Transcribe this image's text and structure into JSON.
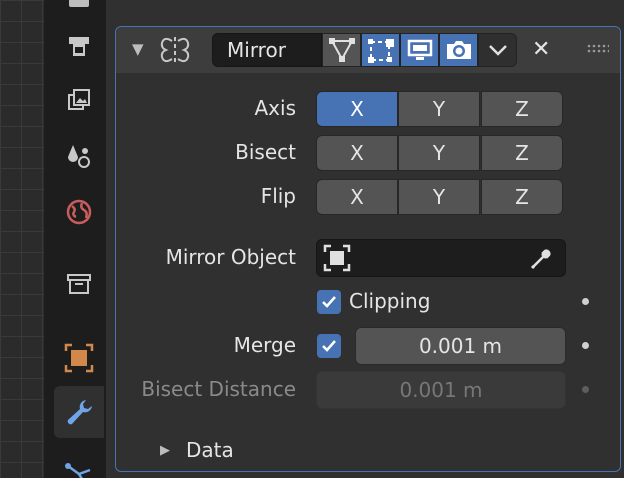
{
  "properties_tabs": [
    {
      "id": "render",
      "icon": "render-icon",
      "active": false
    },
    {
      "id": "output",
      "icon": "printer-icon",
      "active": false
    },
    {
      "id": "view_layer",
      "icon": "images-icon",
      "active": false
    },
    {
      "id": "scene",
      "icon": "scene-icon",
      "active": false
    },
    {
      "id": "world",
      "icon": "world-icon",
      "active": false
    },
    {
      "id": "collection",
      "icon": "box-icon",
      "active": false
    },
    {
      "id": "object",
      "icon": "object-icon",
      "active": false
    },
    {
      "id": "modifiers",
      "icon": "wrench-icon",
      "active": true
    },
    {
      "id": "particles",
      "icon": "particles-icon",
      "active": false
    }
  ],
  "modifier": {
    "icon": "mirror-modifier-icon",
    "name": "Mirror",
    "toggles": [
      {
        "id": "edit_cage",
        "icon": "triangle-vertex-icon",
        "on": false
      },
      {
        "id": "edit_mode",
        "icon": "editmode-square-icon",
        "on": true
      },
      {
        "id": "viewport",
        "icon": "monitor-icon",
        "on": true
      },
      {
        "id": "render",
        "icon": "camera-icon",
        "on": true
      }
    ],
    "menu_icon": "chevron-down-icon",
    "close_icon": "close-icon",
    "drag_icon": "drag-handle-icon"
  },
  "axis": {
    "label": "Axis",
    "options": [
      "X",
      "Y",
      "Z"
    ],
    "selected": [
      "X"
    ]
  },
  "bisect": {
    "label": "Bisect",
    "options": [
      "X",
      "Y",
      "Z"
    ],
    "selected": []
  },
  "flip": {
    "label": "Flip",
    "options": [
      "X",
      "Y",
      "Z"
    ],
    "selected": []
  },
  "mirror_object": {
    "label": "Mirror Object",
    "value": "",
    "icon": "object-square-icon",
    "eyedropper_icon": "eyedropper-icon"
  },
  "clipping": {
    "label": "Clipping",
    "checked": true
  },
  "merge": {
    "label": "Merge",
    "checked": true,
    "value": "0.001 m"
  },
  "bisect_distance": {
    "label": "Bisect Distance",
    "value": "0.001 m",
    "enabled": false
  },
  "data_subpanel": {
    "label": "Data",
    "expanded": false
  },
  "colors": {
    "accent": "#4772b3",
    "panel_bg": "#303030",
    "header_bg": "#3d3d3d",
    "field_bg": "#1d1d1d",
    "button_bg": "#545454"
  }
}
